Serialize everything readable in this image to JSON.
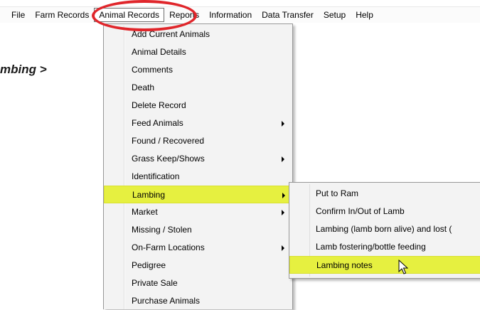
{
  "menubar": {
    "items": [
      "File",
      "Farm Records",
      "Animal Records",
      "Reports",
      "Information",
      "Data Transfer",
      "Setup",
      "Help"
    ]
  },
  "page_heading_fragment": "mbing >",
  "animal_records_menu": {
    "items": [
      {
        "label": "Add Current Animals",
        "submenu": false
      },
      {
        "label": "Animal Details",
        "submenu": false
      },
      {
        "label": "Comments",
        "submenu": false
      },
      {
        "label": "Death",
        "submenu": false
      },
      {
        "label": "Delete Record",
        "submenu": false
      },
      {
        "label": "Feed Animals",
        "submenu": true
      },
      {
        "label": "Found / Recovered",
        "submenu": false
      },
      {
        "label": "Grass Keep/Shows",
        "submenu": true
      },
      {
        "label": "Identification",
        "submenu": false
      },
      {
        "label": "Lambing",
        "submenu": true,
        "highlighted": true
      },
      {
        "label": "Market",
        "submenu": true
      },
      {
        "label": "Missing / Stolen",
        "submenu": false
      },
      {
        "label": "On-Farm Locations",
        "submenu": true
      },
      {
        "label": "Pedigree",
        "submenu": false
      },
      {
        "label": "Private Sale",
        "submenu": false
      },
      {
        "label": "Purchase Animals",
        "submenu": false
      }
    ]
  },
  "lambing_submenu": {
    "items": [
      {
        "label": "Put to Ram"
      },
      {
        "label": "Confirm In/Out of Lamb"
      },
      {
        "label": "Lambing (lamb born alive) and  lost ("
      },
      {
        "label": "Lamb fostering/bottle feeding"
      },
      {
        "label": "Lambing notes",
        "highlighted": true
      }
    ]
  },
  "colors": {
    "highlight": "#e6f040",
    "annotation_circle": "#e0262b"
  }
}
